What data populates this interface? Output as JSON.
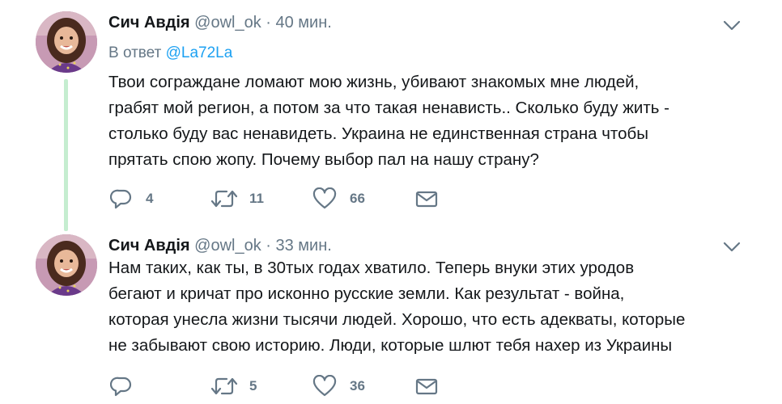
{
  "tweets": [
    {
      "author_name": "Сич Авдія",
      "handle": "@owl_ok",
      "separator": "·",
      "time": "40 мин.",
      "reply_label": "В ответ",
      "reply_mention": "@La72La",
      "text_lines": [
        "Твои сограждане ломают мою жизнь, убивают знакомых мне людей,",
        "грабят мой регион, а потом за что такая ненависть.. Сколько буду жить -",
        "столько буду вас ненавидеть. Украина не единственная страна чтобы",
        "прятать спою жопу. Почему выбор пал на нашу страну?"
      ],
      "replies": "4",
      "retweets": "11",
      "likes": "66"
    },
    {
      "author_name": "Сич Авдія",
      "handle": "@owl_ok",
      "separator": "·",
      "time": "33 мин.",
      "text_lines": [
        "Нам таких, как ты, в 30тых годах хватило. Теперь внуки этих уродов",
        "бегают и кричат про исконно русские земли. Как результат - война,",
        "которая унесла жизни тысячи людей. Хорошо, что есть адекваты, которые",
        "не забывают свою историю. Люди, которые шлют тебя нахер из Украины"
      ],
      "replies": "",
      "retweets": "5",
      "likes": "36"
    }
  ],
  "icons": {
    "reply": "reply-icon",
    "retweet": "retweet-icon",
    "like": "heart-icon",
    "dm": "envelope-icon",
    "menu": "chevron-down-icon"
  },
  "colors": {
    "text": "#14171a",
    "secondary": "#657786",
    "mention": "#1da1f2",
    "thread_line": "#c5edd0"
  }
}
